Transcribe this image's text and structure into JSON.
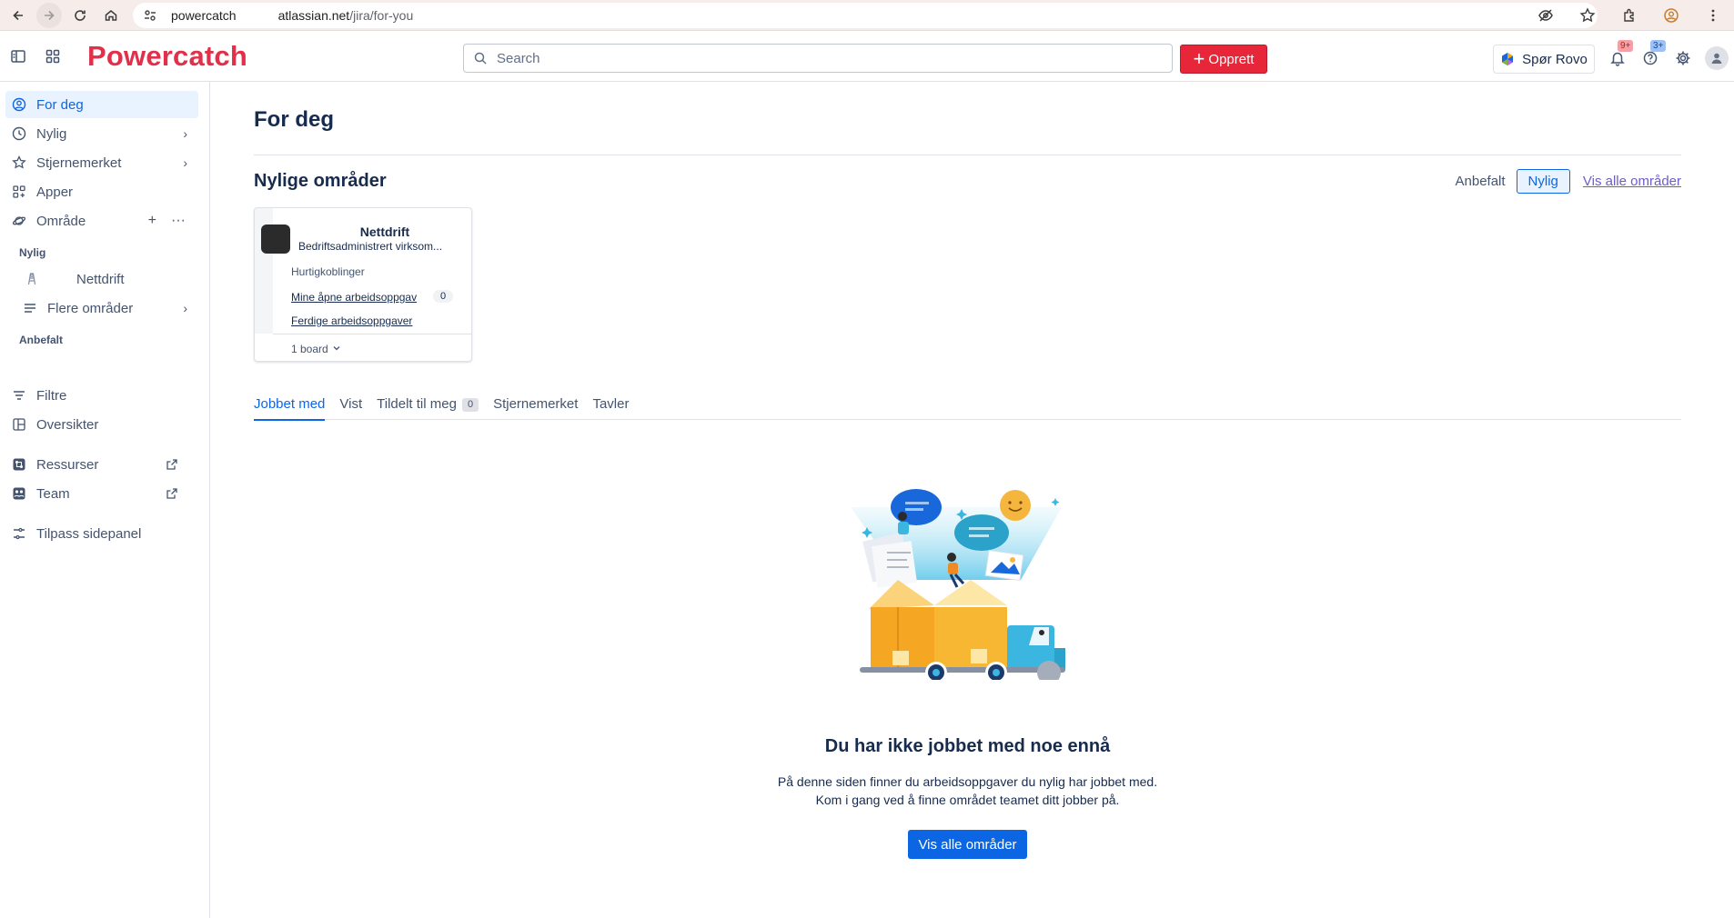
{
  "browser": {
    "url_host_start": "powercatch",
    "url_host_end": "atlassian.net",
    "url_path": "/jira/for-you"
  },
  "topbar": {
    "logo": "Powercatch",
    "search_placeholder": "Search",
    "create_label": "Opprett",
    "rovo_label": "Spør Rovo",
    "notifications_badge": "9+",
    "help_badge": "3+"
  },
  "sidebar": {
    "for_you": "For deg",
    "recent": "Nylig",
    "starred": "Stjernemerket",
    "apps": "Apper",
    "spaces": "Område",
    "recent_section": "Nylig",
    "project": "Nettdrift",
    "more_spaces": "Flere områder",
    "recommended_section": "Anbefalt",
    "filters": "Filtre",
    "dashboards": "Oversikter",
    "resources": "Ressurser",
    "team": "Team",
    "customize": "Tilpass sidepanel"
  },
  "main": {
    "title": "For deg",
    "recent_spaces_title": "Nylige områder",
    "seg_recommended": "Anbefalt",
    "seg_recent": "Nylig",
    "view_all_link": "Vis alle områder",
    "card": {
      "name": "Nettdrift",
      "type": "Bedriftsadministrert virksom...",
      "quick_links": "Hurtigkoblinger",
      "open_tasks": "Mine åpne arbeidsoppgav",
      "open_count": "0",
      "done_tasks": "Ferdige arbeidsoppgaver",
      "boards": "1 board"
    },
    "tabs": {
      "worked_on": "Jobbet med",
      "viewed": "Vist",
      "assigned": "Tildelt til meg",
      "assigned_count": "0",
      "starred": "Stjernemerket",
      "boards": "Tavler"
    },
    "empty": {
      "title": "Du har ikke jobbet med noe ennå",
      "line1": "På denne siden finner du arbeidsoppgaver du nylig har jobbet med.",
      "line2": "Kom i gang ved å finne området teamet ditt jobber på.",
      "cta": "Vis alle områder"
    }
  },
  "colors": {
    "brand": "#e2304a",
    "accent": "#0c66e4",
    "create": "#e8263a"
  }
}
